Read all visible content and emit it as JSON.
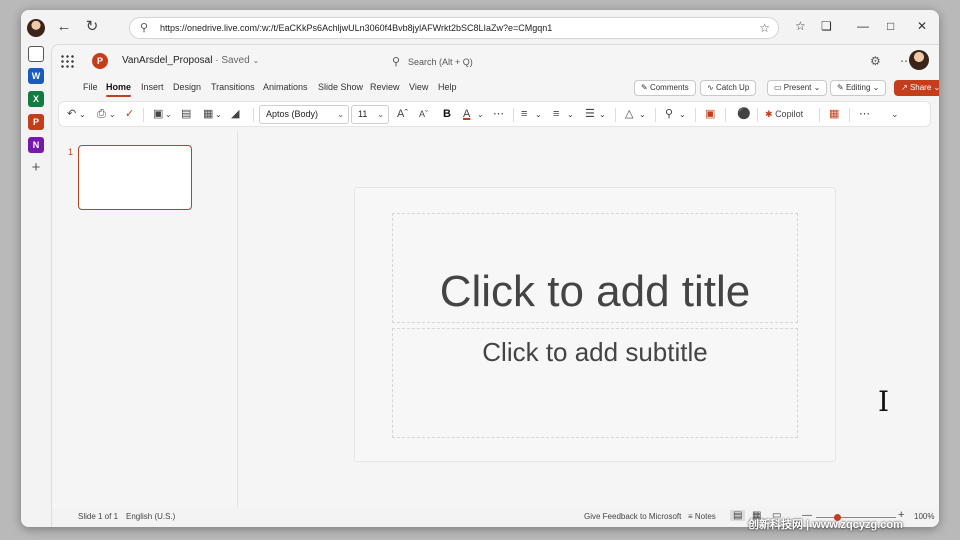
{
  "browser": {
    "url": "https://onedrive.live.com/:w:/t/EaCKkPs6AchljwULn3060f4Bvb8jylAFWrkt2bSC8LIaZw?e=CMgqn1"
  },
  "edge_sidebar": {
    "apps": [
      {
        "name": "word",
        "letter": "W",
        "color": "#185abd"
      },
      {
        "name": "excel",
        "letter": "X",
        "color": "#107c41"
      },
      {
        "name": "powerpoint",
        "letter": "P",
        "color": "#c43e1c"
      },
      {
        "name": "onenote",
        "letter": "N",
        "color": "#7719aa"
      }
    ],
    "add_label": "+"
  },
  "app": {
    "logo_letter": "P",
    "doc_name": "VanArsdel_Proposal",
    "save_status": "· Saved",
    "search_placeholder": "Search (Alt + Q)"
  },
  "menu": {
    "tabs": [
      "File",
      "Home",
      "Insert",
      "Design",
      "Transitions",
      "Animations",
      "Slide Show",
      "Review",
      "View",
      "Help"
    ],
    "active": "Home",
    "comments": "Comments",
    "catch_up": "Catch Up",
    "present": "Present",
    "editing": "Editing",
    "share": "Share"
  },
  "ribbon": {
    "font_name": "Aptos (Body)",
    "font_size": "11",
    "bold": "B",
    "font_color": "A",
    "copilot": "Copilot"
  },
  "thumbnails": {
    "number": "1"
  },
  "slide": {
    "title_placeholder": "Click to add title",
    "subtitle_placeholder": "Click to add subtitle"
  },
  "status": {
    "slide_count": "Slide 1 of 1",
    "language": "English (U.S.)",
    "feedback": "Give Feedback to Microsoft",
    "notes": "Notes",
    "zoom": "100%"
  },
  "watermark": "创新科技网 | www.zqcyzg.com"
}
